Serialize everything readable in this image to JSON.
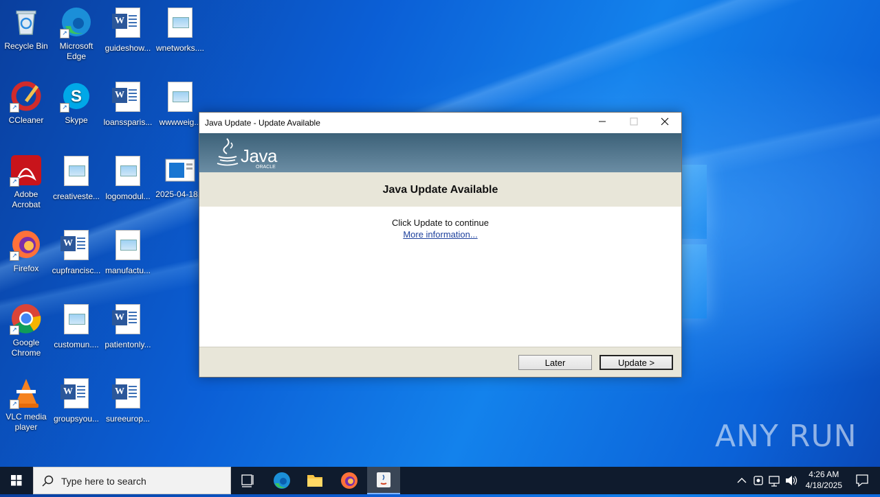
{
  "desktop": {
    "icons": [
      {
        "label": "Recycle Bin"
      },
      {
        "label": "Microsoft Edge"
      },
      {
        "label": "guideshow..."
      },
      {
        "label": "wnetworks...."
      },
      {
        "label": "CCleaner"
      },
      {
        "label": "Skype"
      },
      {
        "label": "loanssparis..."
      },
      {
        "label": "wwwweig..."
      },
      {
        "label": "Adobe Acrobat"
      },
      {
        "label": "creativeste..."
      },
      {
        "label": "logomodul..."
      },
      {
        "label": "2025-04-18..."
      },
      {
        "label": "Firefox"
      },
      {
        "label": "cupfrancisc..."
      },
      {
        "label": "manufactu..."
      },
      {
        "label": "Google Chrome"
      },
      {
        "label": "customun...."
      },
      {
        "label": "patientonly..."
      },
      {
        "label": "VLC media player"
      },
      {
        "label": "groupsyou..."
      },
      {
        "label": "sureeurop..."
      }
    ]
  },
  "dialog": {
    "title": "Java Update - Update Available",
    "logo_text": "Java",
    "logo_sub": "ORACLE",
    "heading": "Java Update Available",
    "message": "Click Update to continue",
    "link": "More information...",
    "later_button": "Later",
    "update_button": "Update >",
    "accent": "#3c6178"
  },
  "taskbar": {
    "search_placeholder": "Type here to search",
    "time": "4:26 AM",
    "date": "4/18/2025"
  },
  "watermark": "ANY RUN"
}
